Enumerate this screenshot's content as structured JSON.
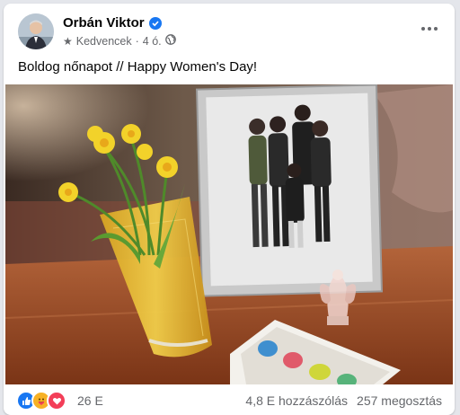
{
  "post": {
    "author": "Orbán Viktor",
    "audience_label": "Kedvencek",
    "time": "4 ó.",
    "text": "Boldog nőnapot // Happy Women's Day!"
  },
  "reactions": {
    "types": [
      "like-icon",
      "care-icon",
      "love-icon"
    ],
    "count": "26 E"
  },
  "stats": {
    "comments": "4,8 E hozzászólás",
    "shares": "257 megosztás"
  },
  "colors": {
    "accent": "#1877f2",
    "love": "#f33e58",
    "care": "#f7b125",
    "muted_text": "#65676b"
  }
}
